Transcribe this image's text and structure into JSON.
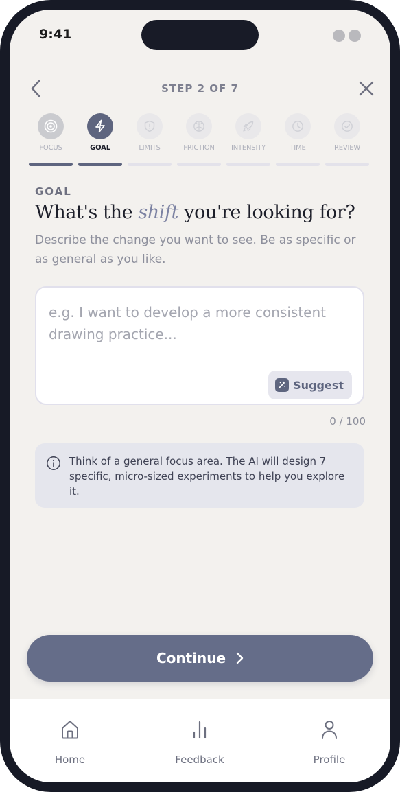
{
  "status_bar": {
    "time": "9:41"
  },
  "header": {
    "step_label": "STEP 2 OF 7"
  },
  "steps": [
    {
      "label": "FOCUS",
      "state": "done",
      "icon": "target-icon"
    },
    {
      "label": "GOAL",
      "state": "current",
      "icon": "lightning-icon"
    },
    {
      "label": "LIMITS",
      "state": "todo",
      "icon": "shield-icon"
    },
    {
      "label": "FRICTION",
      "state": "todo",
      "icon": "brain-icon"
    },
    {
      "label": "INTENSITY",
      "state": "todo",
      "icon": "rocket-icon"
    },
    {
      "label": "TIME",
      "state": "todo",
      "icon": "clock-icon"
    },
    {
      "label": "REVIEW",
      "state": "todo",
      "icon": "check-circle-icon"
    }
  ],
  "main": {
    "section_label": "GOAL",
    "headline_pre": "What's the",
    "headline_accent": "shift",
    "headline_post": "you're looking for?",
    "subtitle": "Describe the change you want to see. Be as specific or as general as you like.",
    "goal_input": {
      "value": "",
      "placeholder": "e.g. I want to develop a more consistent drawing practice..."
    },
    "suggest_label": "Suggest",
    "counter": "0 / 100",
    "info_text": "Think of a general focus area. The AI will design 7 specific, micro-sized experiments to help you explore it."
  },
  "continue_label": "Continue",
  "bottom_nav": {
    "items": [
      {
        "label": "Home",
        "icon": "home-icon"
      },
      {
        "label": "Feedback",
        "icon": "bar-chart-icon"
      },
      {
        "label": "Profile",
        "icon": "user-icon"
      }
    ]
  },
  "colors": {
    "accent": "#5e657f",
    "continue_button": "#656d89",
    "background": "#f3f1ee",
    "headline_accent": "#7c82a2"
  }
}
